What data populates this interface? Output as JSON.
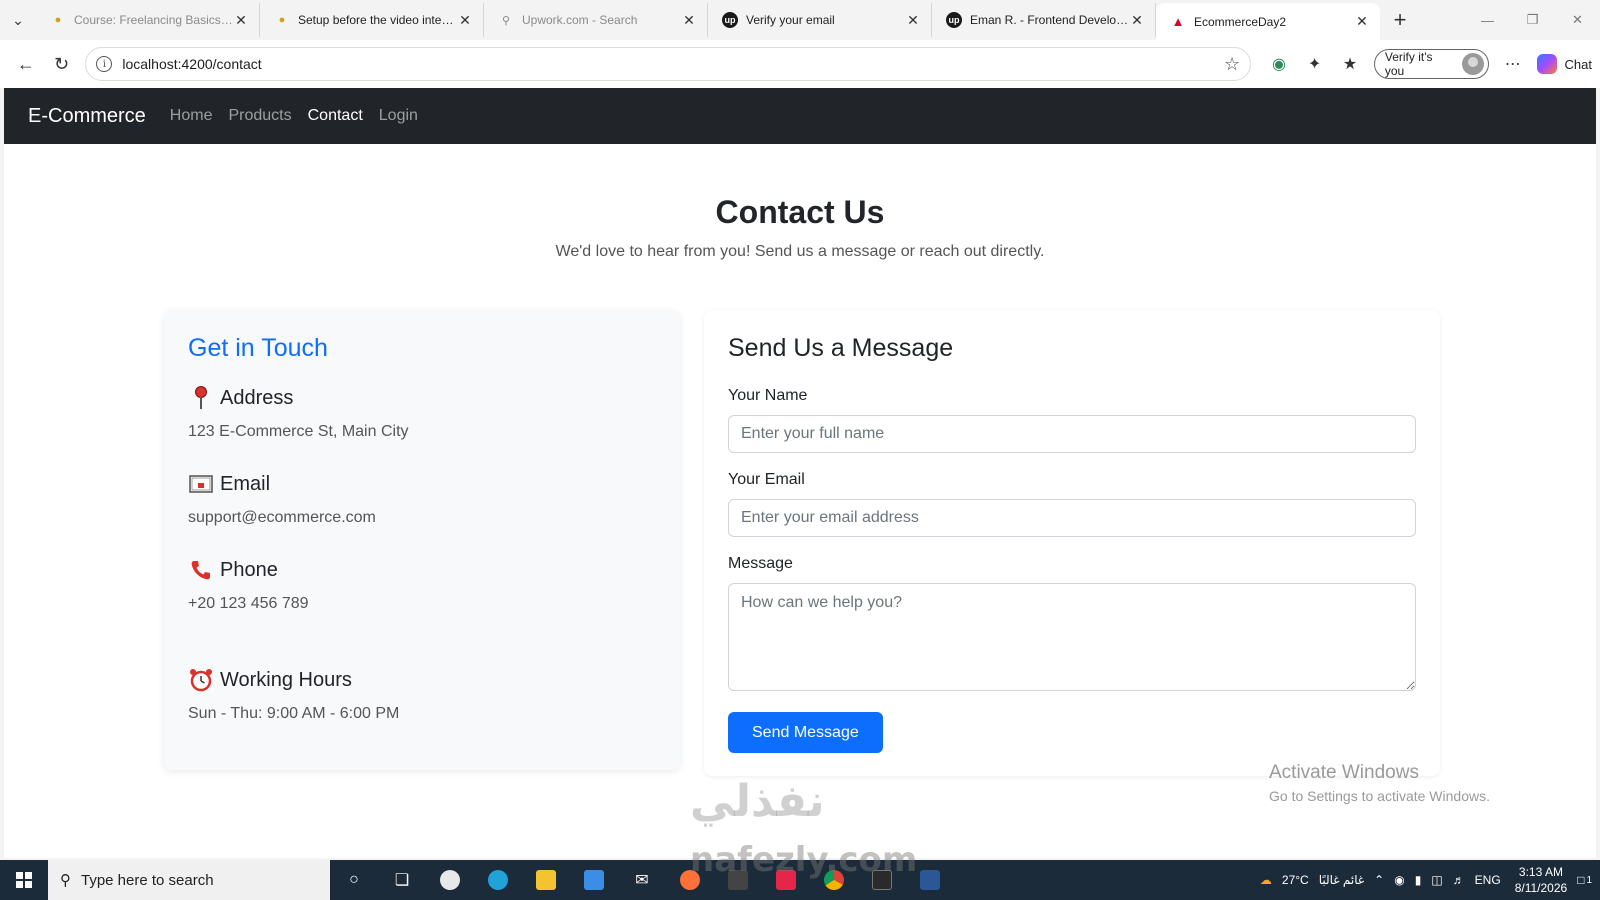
{
  "browser": {
    "tabs": [
      {
        "title": "Course: Freelancing Basics | Ma",
        "style": "dim",
        "favicon": "torch-icon"
      },
      {
        "title": "Setup before the video intervie",
        "style": "dark",
        "favicon": "torch-icon"
      },
      {
        "title": "Upwork.com - Search",
        "style": "dim",
        "favicon": "search-icon"
      },
      {
        "title": "Verify your email",
        "style": "dark",
        "favicon": "upwork-icon"
      },
      {
        "title": "Eman R. - Frontend Developer |",
        "style": "dark",
        "favicon": "upwork-icon"
      },
      {
        "title": "EcommerceDay2",
        "style": "active",
        "favicon": "angular-icon"
      }
    ],
    "url": "localhost:4200/contact",
    "profile_label": "Verify it's you",
    "chat_label": "Chat"
  },
  "navbar": {
    "brand": "E-Commerce",
    "links": [
      {
        "label": "Home",
        "active": false
      },
      {
        "label": "Products",
        "active": false
      },
      {
        "label": "Contact",
        "active": true
      },
      {
        "label": "Login",
        "active": false
      }
    ]
  },
  "hero": {
    "title": "Contact Us",
    "subtitle": "We'd love to hear from you! Send us a message or reach out directly."
  },
  "info": {
    "title": "Get in Touch",
    "address": {
      "label": "Address",
      "value": "123 E-Commerce St, Main City",
      "icon": "pushpin-icon"
    },
    "email": {
      "label": "Email",
      "value": "support@ecommerce.com",
      "icon": "envelope-icon"
    },
    "phone": {
      "label": "Phone",
      "value": "+20 123 456 789",
      "icon": "phone-icon"
    },
    "hours": {
      "label": "Working Hours",
      "value": "Sun - Thu: 9:00 AM - 6:00 PM",
      "icon": "alarm-clock-icon"
    }
  },
  "form": {
    "title": "Send Us a Message",
    "name_label": "Your Name",
    "name_placeholder": "Enter your full name",
    "email_label": "Your Email",
    "email_placeholder": "Enter your email address",
    "message_label": "Message",
    "message_placeholder": "How can we help you?",
    "submit_label": "Send Message"
  },
  "os": {
    "activate_title": "Activate Windows",
    "activate_subtitle": "Go to Settings to activate Windows.",
    "watermark_arabic": "نفذلي",
    "watermark_latin": "nafezly.com",
    "search_placeholder": "Type here to search",
    "weather": "27°C",
    "weather_desc": "غائم غالبًا",
    "language": "ENG",
    "time": "3:13 AM",
    "date": "8/11/2026",
    "notification_count": "1"
  },
  "colors": {
    "primary": "#0d6efd",
    "navbar_bg": "#212529",
    "info_card_bg": "#f8f9fa",
    "taskbar_bg": "#1c2b3a"
  }
}
